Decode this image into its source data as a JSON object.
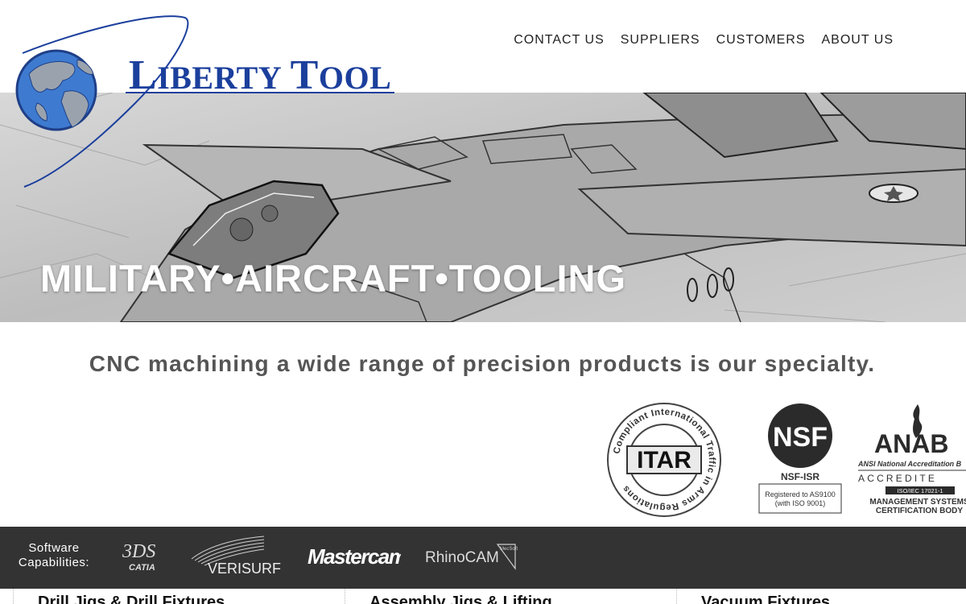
{
  "brand": {
    "name_part1_initial": "L",
    "name_part1_rest": "IBERTY",
    "name_part2_initial": "T",
    "name_part2_rest": "OOL"
  },
  "nav": {
    "items": [
      {
        "label": "CONTACT US"
      },
      {
        "label": "SUPPLIERS"
      },
      {
        "label": "CUSTOMERS"
      },
      {
        "label": "ABOUT US"
      }
    ]
  },
  "hero": {
    "title": "MILITARY•AIRCRAFT•TOOLING"
  },
  "tagline": "CNC machining a wide range of precision products is our specialty.",
  "certifications": {
    "itar": {
      "center": "ITAR",
      "ring_text": "Compliant  International Traffic in Arms Regulations"
    },
    "nsf": {
      "logo": "NSF",
      "sub": "NSF-ISR",
      "box_line1": "Registered to AS9100",
      "box_line2": "(with ISO 9001)"
    },
    "anab": {
      "logo": "ANAB",
      "line1": "ANSI National Accreditation B",
      "line2": "ACCREDITE",
      "line3": "ISO/IEC 17021-1",
      "line4": "MANAGEMENT SYSTEMS",
      "line5": "CERTIFICATION BODY"
    }
  },
  "software": {
    "label_line1": "Software",
    "label_line2": "Capabilities:",
    "logos": {
      "catia": "CATIA",
      "verisurf": "VERISURF",
      "mastercam": "Mastercam",
      "rhinocam": "RhinoCAM",
      "rhinocam_badge": "MecSoft"
    }
  },
  "columns": [
    {
      "label": "Drill Jigs & Drill Fixtures"
    },
    {
      "label": "Assembly Jigs & Lifting"
    },
    {
      "label": "Vacuum Fixtures"
    }
  ],
  "colors": {
    "brand_blue": "#1b3f9c",
    "globe_blue": "#3e7bd0",
    "software_bar": "#333333",
    "tagline_gray": "#555555"
  }
}
